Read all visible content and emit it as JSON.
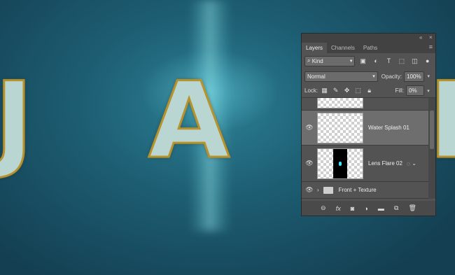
{
  "canvas": {
    "letters": [
      "J",
      "A",
      "M"
    ]
  },
  "panel": {
    "tabs": [
      "Layers",
      "Channels",
      "Paths"
    ],
    "filter": {
      "label": "Kind"
    },
    "blend_mode": "Normal",
    "opacity_label": "Opacity:",
    "opacity_value": "100%",
    "lock_label": "Lock:",
    "fill_label": "Fill:",
    "fill_value": "0%",
    "layers": [
      {
        "name": "Water Splash 01",
        "selected": true
      },
      {
        "name": "Lens Flare 02",
        "selected": false
      },
      {
        "name": "Front + Texture",
        "selected": false,
        "type": "group"
      }
    ]
  },
  "icons": {
    "filter_icons": [
      "image-filter-icon",
      "adjustment-filter-icon",
      "type-filter-icon",
      "shape-filter-icon",
      "smart-object-filter-icon"
    ],
    "lock_icons": [
      "lock-transparent-icon",
      "lock-image-icon",
      "lock-position-icon",
      "lock-artboard-icon",
      "lock-all-icon"
    ],
    "bottom_icons": [
      "link-layers-icon",
      "fx-icon",
      "add-mask-icon",
      "adjustment-layer-icon",
      "new-group-icon",
      "new-layer-icon",
      "delete-layer-icon"
    ]
  }
}
